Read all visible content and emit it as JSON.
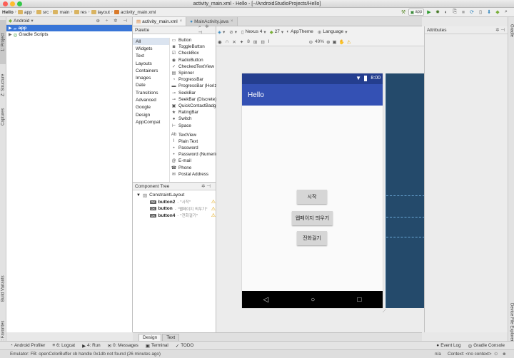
{
  "window": {
    "title": "activity_main.xml - Hello - [~/AndroidStudioProjects/Hello]"
  },
  "breadcrumbs": [
    "Hello",
    "app",
    "src",
    "main",
    "res",
    "layout",
    "activity_main.xml"
  ],
  "run_config": "app",
  "project_panel": {
    "view": "Android",
    "tree": [
      {
        "label": "app",
        "selected": true
      },
      {
        "label": "Gradle Scripts",
        "selected": false
      }
    ]
  },
  "left_tools": [
    "1: Project",
    "Z: Structure",
    "Captures",
    "Build Variants",
    "2: Favorites"
  ],
  "right_tools": [
    "Gradle",
    "Device File Explorer"
  ],
  "editor_tabs": [
    {
      "label": "activity_main.xml",
      "active": true
    },
    {
      "label": "MainActivity.java",
      "active": false
    }
  ],
  "palette": {
    "title": "Palette",
    "categories": [
      "All",
      "Widgets",
      "Text",
      "Layouts",
      "Containers",
      "Images",
      "Date",
      "Transitions",
      "Advanced",
      "Google",
      "Design",
      "AppCompat"
    ],
    "items": [
      {
        "icon": "button-widget-icon",
        "glyph": "▭",
        "label": "Button"
      },
      {
        "icon": "toggle-button-icon",
        "glyph": "◙",
        "label": "ToggleButton"
      },
      {
        "icon": "checkbox-icon",
        "glyph": "☑",
        "label": "CheckBox"
      },
      {
        "icon": "radio-button-icon",
        "glyph": "◉",
        "label": "RadioButton"
      },
      {
        "icon": "checked-textview-icon",
        "glyph": "✓",
        "label": "CheckedTextView"
      },
      {
        "icon": "spinner-icon",
        "glyph": "▤",
        "label": "Spinner"
      },
      {
        "icon": "progressbar-icon",
        "glyph": "◔",
        "label": "ProgressBar"
      },
      {
        "icon": "progressbar-horizontal-icon",
        "glyph": "▬",
        "label": "ProgressBar (Horizontal)"
      },
      {
        "icon": "seekbar-icon",
        "glyph": "⊸",
        "label": "SeekBar"
      },
      {
        "icon": "seekbar-discrete-icon",
        "glyph": "⊸",
        "label": "SeekBar (Discrete)"
      },
      {
        "icon": "quick-contact-badge-icon",
        "glyph": "▣",
        "label": "QuickContactBadge"
      },
      {
        "icon": "rating-bar-icon",
        "glyph": "★",
        "label": "RatingBar"
      },
      {
        "icon": "switch-icon",
        "glyph": "●",
        "label": "Switch"
      },
      {
        "icon": "space-icon",
        "glyph": "⊢",
        "label": "Space"
      },
      {
        "icon": "textview-icon",
        "glyph": "Ab",
        "label": "TextView"
      },
      {
        "icon": "plain-text-icon",
        "glyph": "I",
        "label": "Plain Text"
      },
      {
        "icon": "password-icon",
        "glyph": "•",
        "label": "Password"
      },
      {
        "icon": "password-numeric-icon",
        "glyph": "•",
        "label": "Password (Numeric)"
      },
      {
        "icon": "email-icon",
        "glyph": "@",
        "label": "E-mail"
      },
      {
        "icon": "phone-icon",
        "glyph": "☎",
        "label": "Phone"
      },
      {
        "icon": "postal-address-icon",
        "glyph": "✉",
        "label": "Postal Address"
      }
    ]
  },
  "component_tree": {
    "title": "Component Tree",
    "root": "ConstraintLayout",
    "children": [
      {
        "id": "button2",
        "text": "- \"시작\""
      },
      {
        "id": "button",
        "text": "- \"웹페이지 띄우기\""
      },
      {
        "id": "button4",
        "text": "- \"전화걸기\""
      }
    ]
  },
  "design_toolbar": {
    "device": "Nexus 4",
    "api": "27",
    "theme": "AppTheme",
    "language": "Language",
    "zoom": "49%"
  },
  "phone": {
    "time": "8:00",
    "app_title": "Hello",
    "buttons": [
      "시작",
      "웹페이지 띄우기",
      "전화걸기"
    ]
  },
  "attributes_title": "Attributes",
  "bottom_tabs": [
    {
      "label": "Design",
      "active": true
    },
    {
      "label": "Text",
      "active": false
    }
  ],
  "tool_windows": [
    {
      "icon": "profiler-icon",
      "glyph": "◔",
      "label": "Android Profiler"
    },
    {
      "icon": "logcat-icon",
      "glyph": "≡",
      "label": "6: Logcat"
    },
    {
      "icon": "run-icon",
      "glyph": "▶",
      "label": "4: Run"
    },
    {
      "icon": "messages-icon",
      "glyph": "✉",
      "label": "0: Messages"
    },
    {
      "icon": "terminal-icon",
      "glyph": "▣",
      "label": "Terminal"
    },
    {
      "icon": "todo-icon",
      "glyph": "✓",
      "label": "TODO"
    },
    {
      "icon": "event-log-icon",
      "glyph": "●",
      "label": "Event Log"
    },
    {
      "icon": "gradle-console-icon",
      "glyph": "◎",
      "label": "Gradle Console"
    }
  ],
  "status": {
    "message": "Emulator: FB: openColorBuffer cb handle 0x1db not found (26 minutes ago)",
    "right": "n/a",
    "context": "Context: <no context>"
  },
  "colors": {
    "app_bar": "#3451b4",
    "status_bar": "#243e8f",
    "blueprint": "#244a6b",
    "selection": "#3875d7",
    "annotation_red": "#e02020"
  }
}
